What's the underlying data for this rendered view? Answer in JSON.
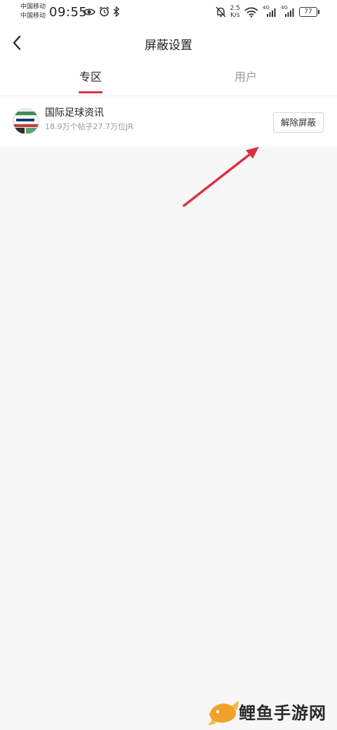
{
  "status_bar": {
    "carrier_1": "中国移动",
    "carrier_2": "中国移动",
    "time": "09:55",
    "speed_value": "2.5",
    "speed_unit": "K/s",
    "signal_1": "4G",
    "signal_2": "4G",
    "battery": "77"
  },
  "header": {
    "title": "屏蔽设置"
  },
  "tabs": [
    {
      "label": "专区",
      "active": true
    },
    {
      "label": "用户",
      "active": false
    }
  ],
  "blocked_list": [
    {
      "name": "国际足球资讯",
      "meta": "18.9万个帖子27.7万位JR",
      "action": "解除屏蔽"
    }
  ],
  "colors": {
    "accent": "#d9333f",
    "background": "#f7f7f7"
  },
  "watermark": {
    "text": "鲤鱼手游网"
  }
}
